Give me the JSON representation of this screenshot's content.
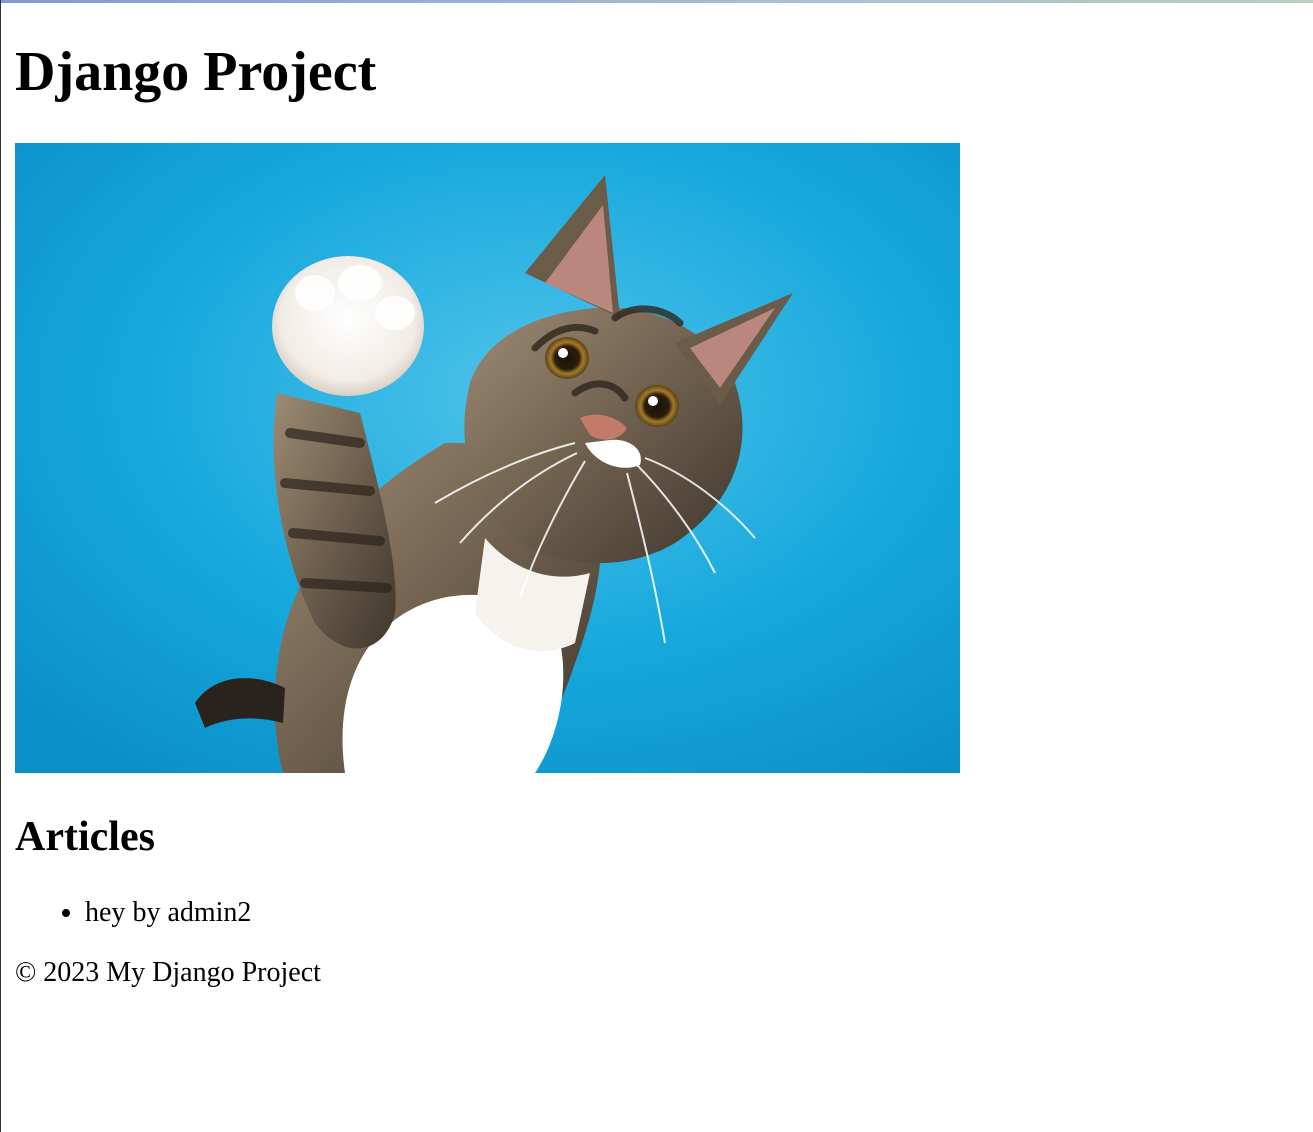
{
  "header": {
    "title": "Django Project"
  },
  "hero_image": {
    "subject": "tabby kitten raising white paw against blue backdrop",
    "background_color": "#12a7da",
    "fur_colors": [
      "#8a7a66",
      "#3f362d",
      "#ffffff"
    ]
  },
  "articles": {
    "heading": "Articles",
    "items": [
      {
        "title": "hey",
        "by_label": "by",
        "author": "admin2"
      }
    ]
  },
  "footer": {
    "text": "© 2023 My Django Project"
  }
}
